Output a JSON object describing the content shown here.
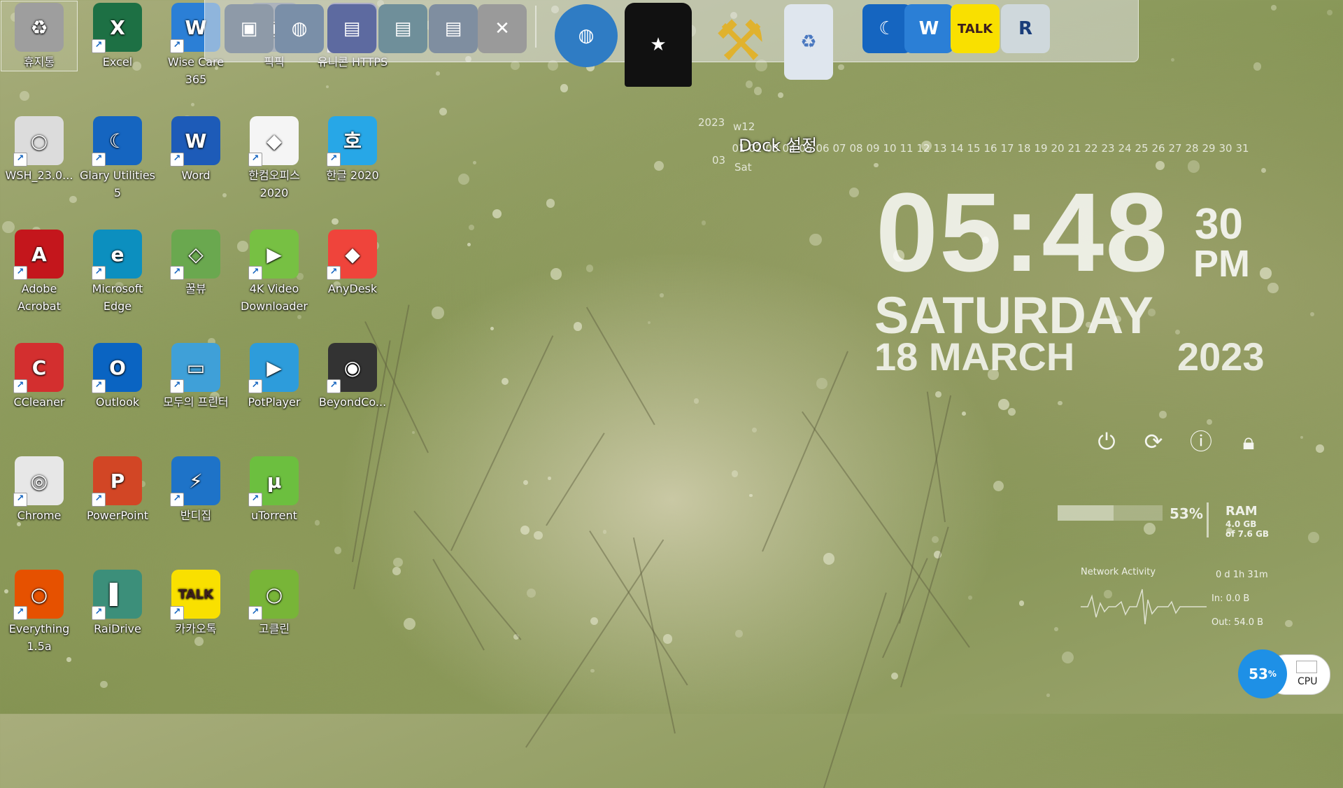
{
  "desktop": {
    "icons": [
      {
        "label": "휴지통",
        "color": "#9e9e9e",
        "glyph": "♻"
      },
      {
        "label": "Excel",
        "color": "#1d7044",
        "glyph": "X"
      },
      {
        "label": "Wise Care 365",
        "color": "#2b7fd6",
        "glyph": "W"
      },
      {
        "label": "픽픽",
        "color": "#6b7a8f",
        "glyph": "▣"
      },
      {
        "label": "유니콘 HTTPS",
        "color": "#6b6ea6",
        "glyph": "▤"
      },
      {
        "label": "WSH_23.0...",
        "color": "#dcdcdc",
        "glyph": "○"
      },
      {
        "label": "Glary Utilities 5",
        "color": "#1565c0",
        "glyph": "☾"
      },
      {
        "label": "Word",
        "color": "#1d5bb8",
        "glyph": "W"
      },
      {
        "label": "한컴오피스 2020",
        "color": "#f5f5f5",
        "glyph": "◆"
      },
      {
        "label": "한글 2020",
        "color": "#27a7e7",
        "glyph": "호"
      },
      {
        "label": "Adobe Acrobat",
        "color": "#c4161c",
        "glyph": "A"
      },
      {
        "label": "Microsoft Edge",
        "color": "#0c8fbf",
        "glyph": "e"
      },
      {
        "label": "꿀뷰",
        "color": "#6aa84f",
        "glyph": "◇"
      },
      {
        "label": "4K Video Downloader",
        "color": "#77c043",
        "glyph": "▶"
      },
      {
        "label": "AnyDesk",
        "color": "#ef443b",
        "glyph": "◆"
      },
      {
        "label": "CCleaner",
        "color": "#d32f2f",
        "glyph": "C"
      },
      {
        "label": "Outlook",
        "color": "#0a64c2",
        "glyph": "O"
      },
      {
        "label": "모두의 프린터",
        "color": "#3fa0d8",
        "glyph": "▭"
      },
      {
        "label": "PotPlayer",
        "color": "#2d9cdb",
        "glyph": "▶"
      },
      {
        "label": "BeyondCo...",
        "color": "#333333",
        "glyph": "◉"
      },
      {
        "label": "Chrome",
        "color": "#e7e7e7",
        "glyph": "◎"
      },
      {
        "label": "PowerPoint",
        "color": "#d24625",
        "glyph": "P"
      },
      {
        "label": "반디집",
        "color": "#1e73c8",
        "glyph": "⚡"
      },
      {
        "label": "uTorrent",
        "color": "#6cbf3f",
        "glyph": "µ"
      },
      {
        "label": "Everything 1.5a",
        "color": "#e65100",
        "glyph": "○"
      },
      {
        "label": "RaiDrive",
        "color": "#3c8f7a",
        "glyph": "▌"
      },
      {
        "label": "카카오톡",
        "color": "#f9e000",
        "glyph": "TALK"
      },
      {
        "label": "고클린",
        "color": "#78b538",
        "glyph": "○"
      }
    ]
  },
  "dock": {
    "items": [
      {
        "name": "pickpick",
        "color": "#8e9aa8",
        "glyph": "▣"
      },
      {
        "name": "network-globe",
        "color": "#7a8fa8",
        "glyph": "◍"
      },
      {
        "name": "folder-https",
        "color": "#5d6aa0",
        "glyph": "▤"
      },
      {
        "name": "folder-green",
        "color": "#6f8f9a",
        "glyph": "▤"
      },
      {
        "name": "folder-blue",
        "color": "#7f8ea0",
        "glyph": "▤"
      },
      {
        "name": "tools",
        "color": "#9a9a9a",
        "glyph": "✕"
      },
      {
        "name": "globe",
        "color": "#2f7cc4",
        "glyph": "◍"
      },
      {
        "name": "tshirt",
        "color": "#111111",
        "glyph": "★"
      },
      {
        "name": "hammer",
        "color": "#e0b22e",
        "glyph": "⚒"
      },
      {
        "name": "recycle-bin",
        "color": "#dfe6ee",
        "glyph": "♻"
      },
      {
        "name": "glary",
        "color": "#1565c0",
        "glyph": "☾"
      },
      {
        "name": "wise",
        "color": "#2b7fd6",
        "glyph": "W"
      },
      {
        "name": "kakaotalk",
        "color": "#f9e000",
        "glyph": "TALK"
      },
      {
        "name": "r-app",
        "color": "#cfd8dc",
        "glyph": "R"
      }
    ],
    "tooltip": "Dock 설정"
  },
  "calendar": {
    "year": "2023",
    "week": "w12",
    "month": "03",
    "weekday": "Sat",
    "days": [
      "01",
      "02",
      "03",
      "04",
      "05",
      "06",
      "07",
      "08",
      "09",
      "10",
      "11",
      "12",
      "13",
      "14",
      "15",
      "16",
      "17",
      "18",
      "19",
      "20",
      "21",
      "22",
      "23",
      "24",
      "25",
      "26",
      "27",
      "28",
      "29",
      "30",
      "31"
    ]
  },
  "clock": {
    "time": "05:48",
    "seconds": "30",
    "ampm": "PM",
    "day": "SATURDAY",
    "date": "18 MARCH",
    "year": "2023"
  },
  "system": {
    "ram_percent": 53,
    "ram_percent_label": "53%",
    "ram_label": "RAM",
    "ram_used": "4.0 GB",
    "ram_total": "of 7.6 GB",
    "network_label": "Network Activity",
    "uptime": "0 d 1h 31m",
    "net_in": "In: 0.0 B",
    "net_out": "Out: 54.0 B",
    "cpu_percent": "53",
    "cpu_unit": "%",
    "cpu_label": "CPU"
  }
}
